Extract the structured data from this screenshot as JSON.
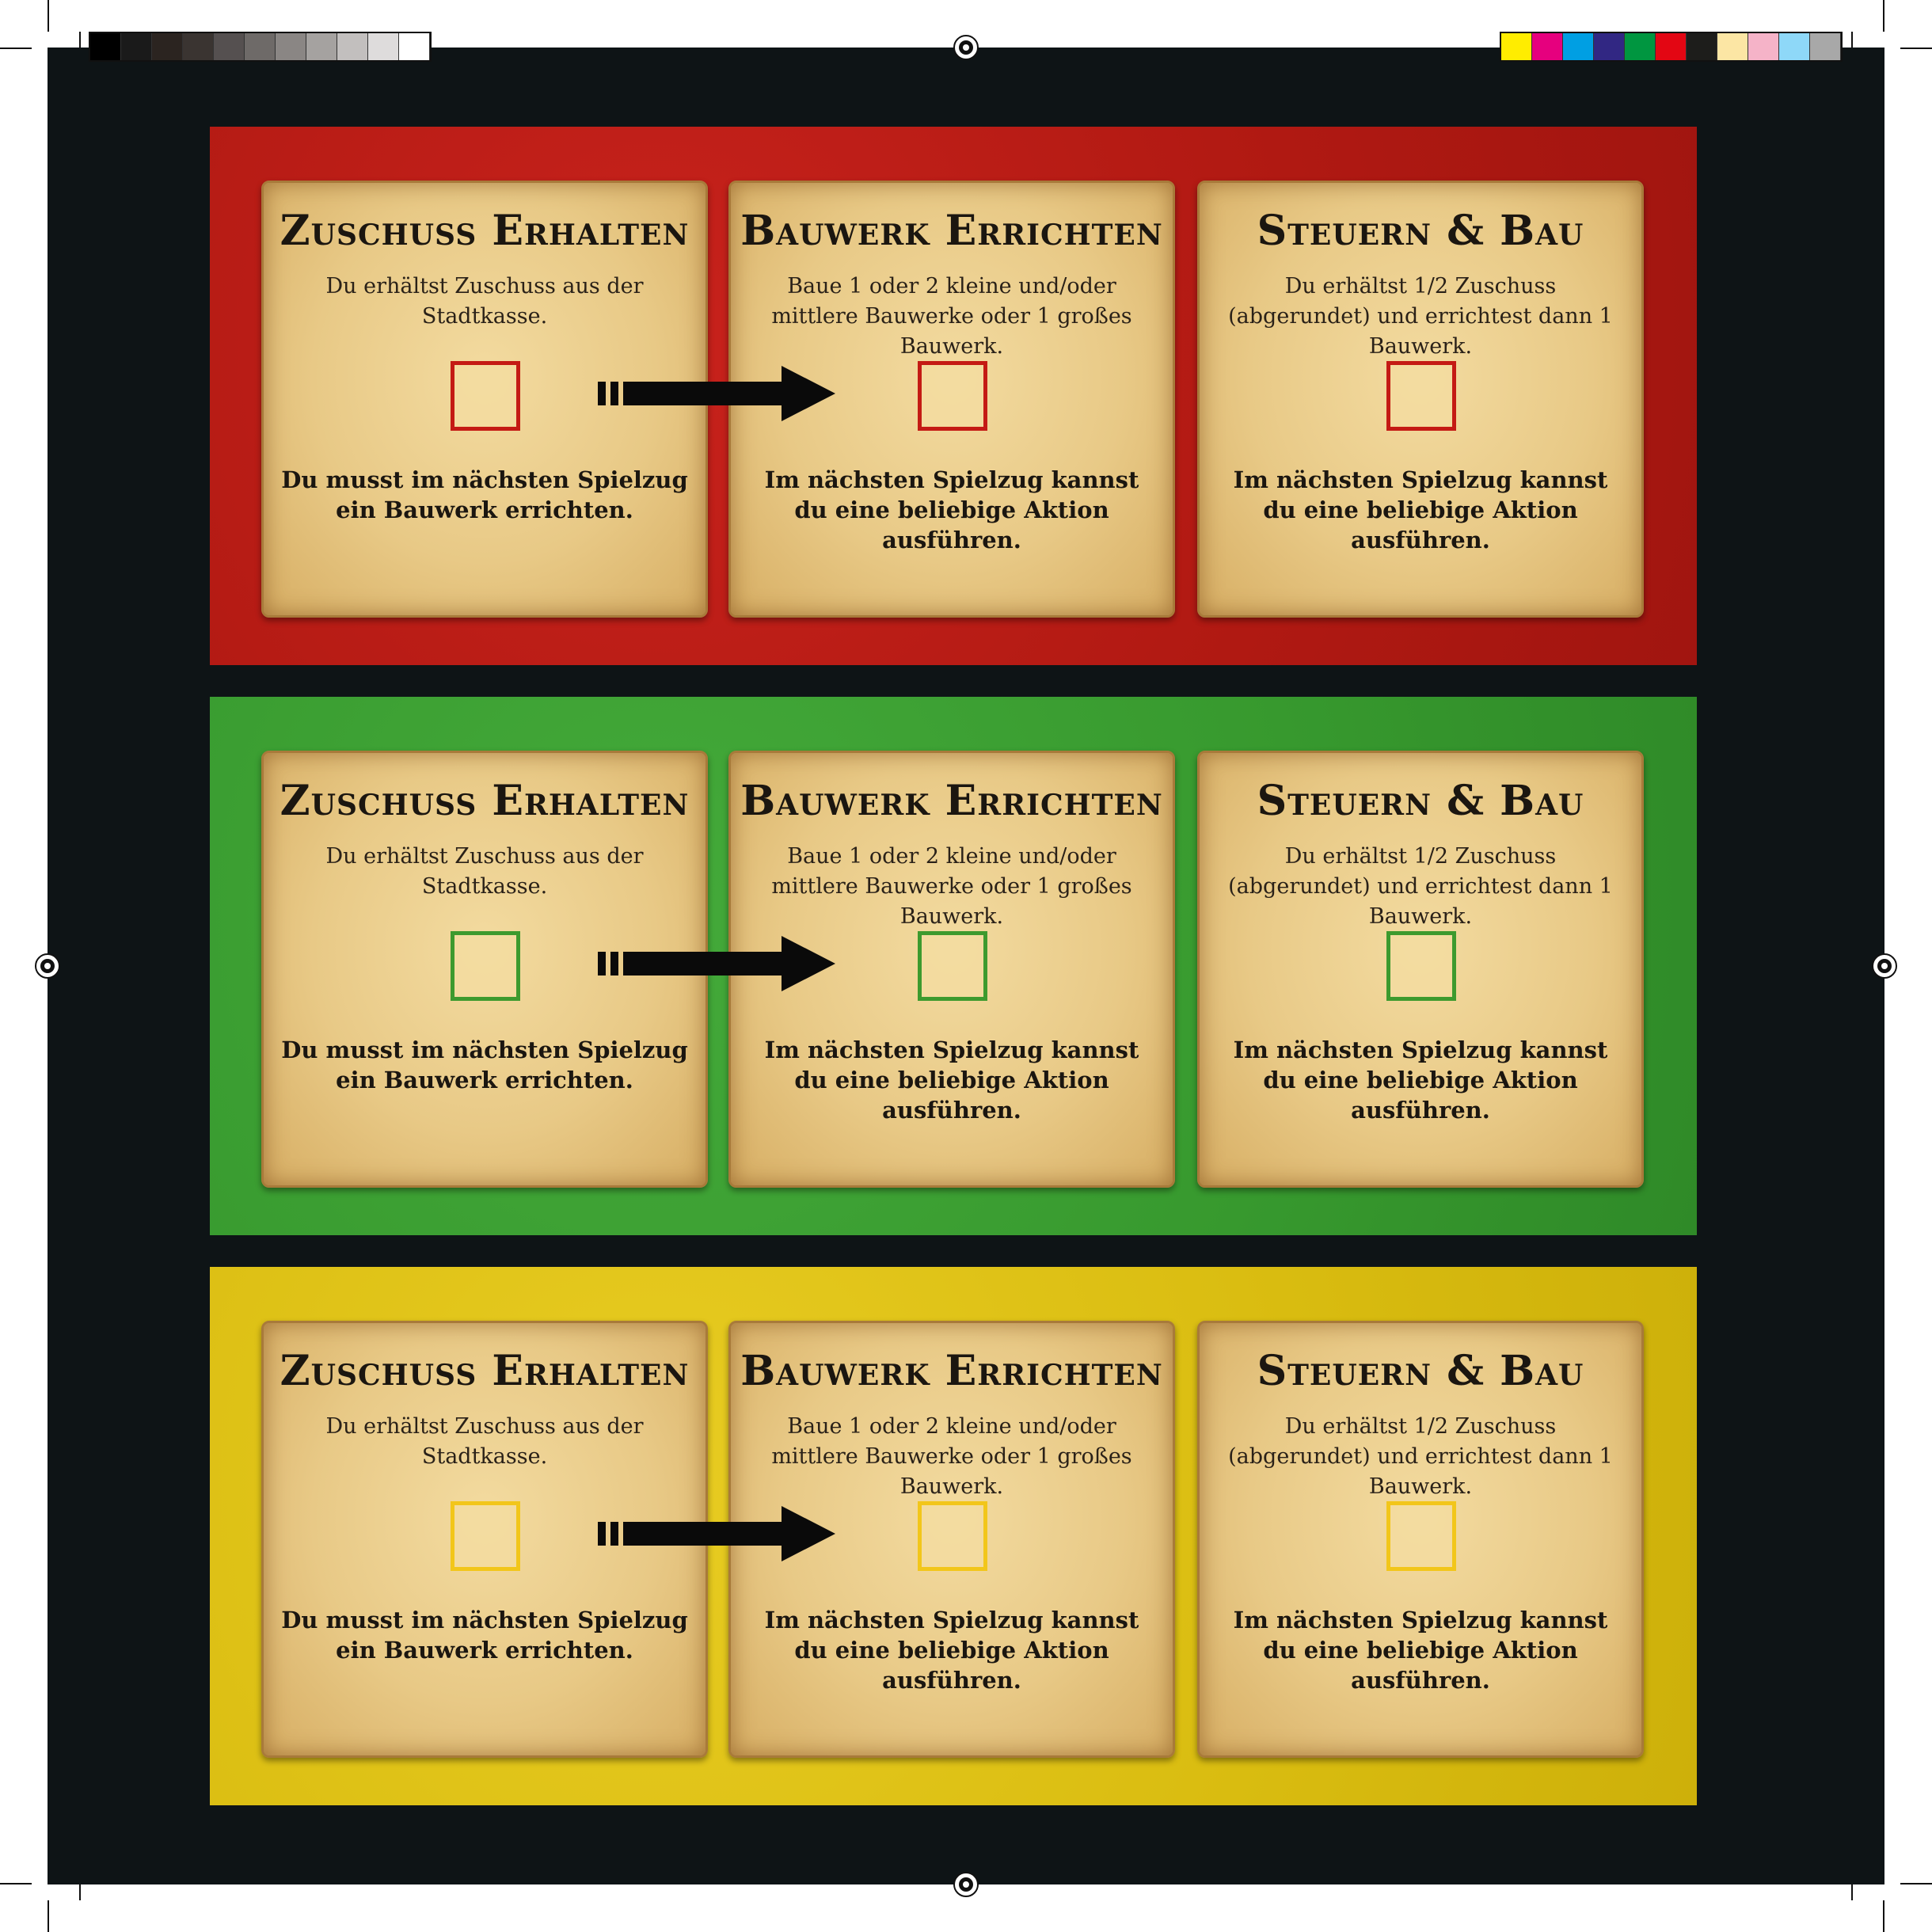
{
  "colors": {
    "sheet_background": "#0e1416",
    "red_panel": "#b01912",
    "green_panel": "#37992e",
    "yellow_panel": "#d9bc10",
    "parchment": "#e8c986"
  },
  "gray_swatches": [
    "#000000",
    "#1a1a1a",
    "#2b2420",
    "#3a3431",
    "#555050",
    "#6e6a68",
    "#8a8684",
    "#a5a2a0",
    "#c2bfbe",
    "#dedcdc",
    "#ffffff"
  ],
  "color_swatches": [
    "#ffed00",
    "#e6007e",
    "#009fe3",
    "#312783",
    "#009640",
    "#e30613",
    "#1d1d1b",
    "#fce6a4",
    "#f5b3c8",
    "#8ed8f8",
    "#a8a8a8"
  ],
  "panels": [
    {
      "color": "red",
      "cards": [
        {
          "title": "Zuschuss Erhalten",
          "desc": "Du erhältst Zuschuss aus der Stadtkasse.",
          "note": "Du musst im nächsten Spielzug ein Bauwerk errichten."
        },
        {
          "title": "Bauwerk Errichten",
          "desc": "Baue 1 oder 2 kleine und/oder mittlere Bauwerke oder 1 großes Bauwerk.",
          "note": "Im nächsten Spielzug kannst du eine beliebige Aktion ausführen."
        },
        {
          "title": "Steuern & Bau",
          "desc": "Du erhältst 1/2 Zuschuss (abgerundet) und errichtest dann 1 Bauwerk.",
          "note": "Im nächsten Spielzug kannst du eine beliebige Aktion ausführen."
        }
      ]
    },
    {
      "color": "green",
      "cards": [
        {
          "title": "Zuschuss Erhalten",
          "desc": "Du erhältst Zuschuss aus der Stadtkasse.",
          "note": "Du musst im nächsten Spielzug ein Bauwerk errichten."
        },
        {
          "title": "Bauwerk Errichten",
          "desc": "Baue 1 oder 2 kleine und/oder mittlere Bauwerke oder 1 großes Bauwerk.",
          "note": "Im nächsten Spielzug kannst du eine beliebige Aktion ausführen."
        },
        {
          "title": "Steuern & Bau",
          "desc": "Du erhältst 1/2 Zuschuss (abgerundet) und errichtest dann 1 Bauwerk.",
          "note": "Im nächsten Spielzug kannst du eine beliebige Aktion ausführen."
        }
      ]
    },
    {
      "color": "yellow",
      "cards": [
        {
          "title": "Zuschuss Erhalten",
          "desc": "Du erhältst Zuschuss aus der Stadtkasse.",
          "note": "Du musst im nächsten Spielzug ein Bauwerk errichten."
        },
        {
          "title": "Bauwerk Errichten",
          "desc": "Baue 1 oder 2 kleine und/oder mittlere Bauwerke oder 1 großes Bauwerk.",
          "note": "Im nächsten Spielzug kannst du eine beliebige Aktion ausführen."
        },
        {
          "title": "Steuern & Bau",
          "desc": "Du erhältst 1/2 Zuschuss (abgerundet) und errichtest dann 1 Bauwerk.",
          "note": "Im nächsten Spielzug kannst du eine beliebige Aktion ausführen."
        }
      ]
    }
  ]
}
